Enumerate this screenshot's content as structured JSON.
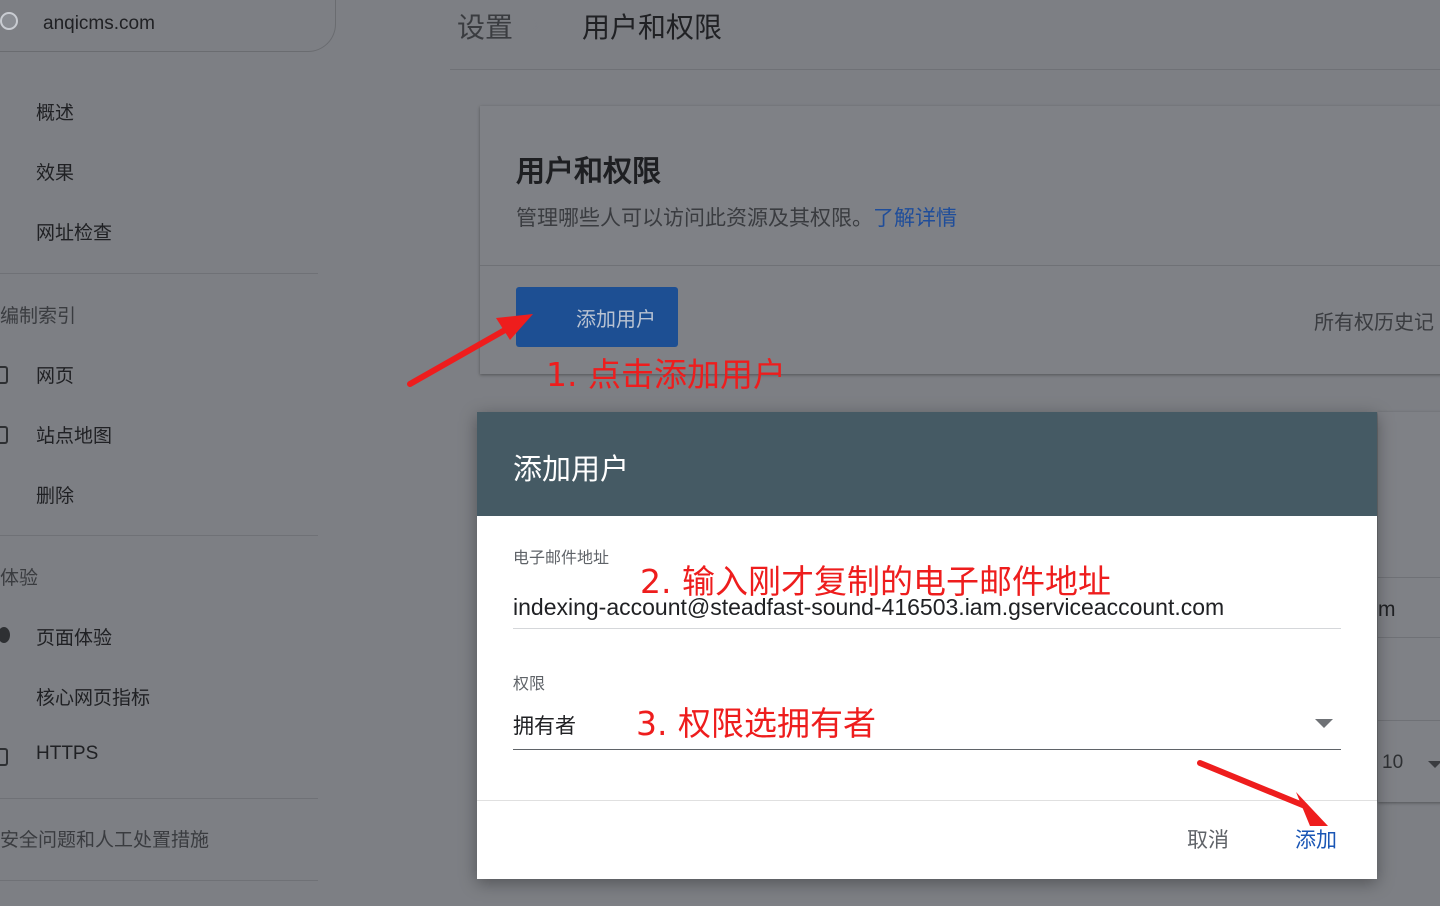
{
  "property": {
    "name": "anqicms.com",
    "icon": "globe-icon"
  },
  "sidebar": {
    "top_items": [
      {
        "label": "概述"
      },
      {
        "label": "效果"
      },
      {
        "label": "网址检查"
      }
    ],
    "index_section": {
      "heading": "编制索引",
      "items": [
        {
          "label": "网页",
          "icon": "page-icon"
        },
        {
          "label": "站点地图",
          "icon": "sitemap-icon"
        },
        {
          "label": "删除"
        }
      ]
    },
    "experience_section": {
      "heading": "体验",
      "items": [
        {
          "label": "页面体验",
          "icon": "experience-icon"
        },
        {
          "label": "核心网页指标"
        },
        {
          "label": "HTTPS",
          "icon": "lock-icon"
        }
      ]
    },
    "security_heading": "安全问题和人工处置措施"
  },
  "header": {
    "settings": "设置",
    "separator": "›",
    "title": "用户和权限"
  },
  "card": {
    "title": "用户和权限",
    "description": "管理哪些人可以访问此资源及其权限。",
    "learn_more": "了解详情",
    "add_user_button": "添加用户",
    "owner_history": "所有权历史记"
  },
  "background_table": {
    "partial_text": "m",
    "rows_per_page": "10"
  },
  "dialog": {
    "title": "添加用户",
    "email_label": "电子邮件地址",
    "email_value": "indexing-account@steadfast-sound-416503.iam.gserviceaccount.com",
    "permission_label": "权限",
    "permission_value": "拥有者",
    "cancel": "取消",
    "add": "添加"
  },
  "annotations": {
    "step1": "1. 点击添加用户",
    "step2": "2. 输入刚才复制的电子邮件地址",
    "step3": "3. 权限选拥有者",
    "color": "#ee1d1d"
  },
  "colors": {
    "dialog_header": "#455a64",
    "primary_button": "#1d4f93",
    "link": "#1a56b5"
  }
}
